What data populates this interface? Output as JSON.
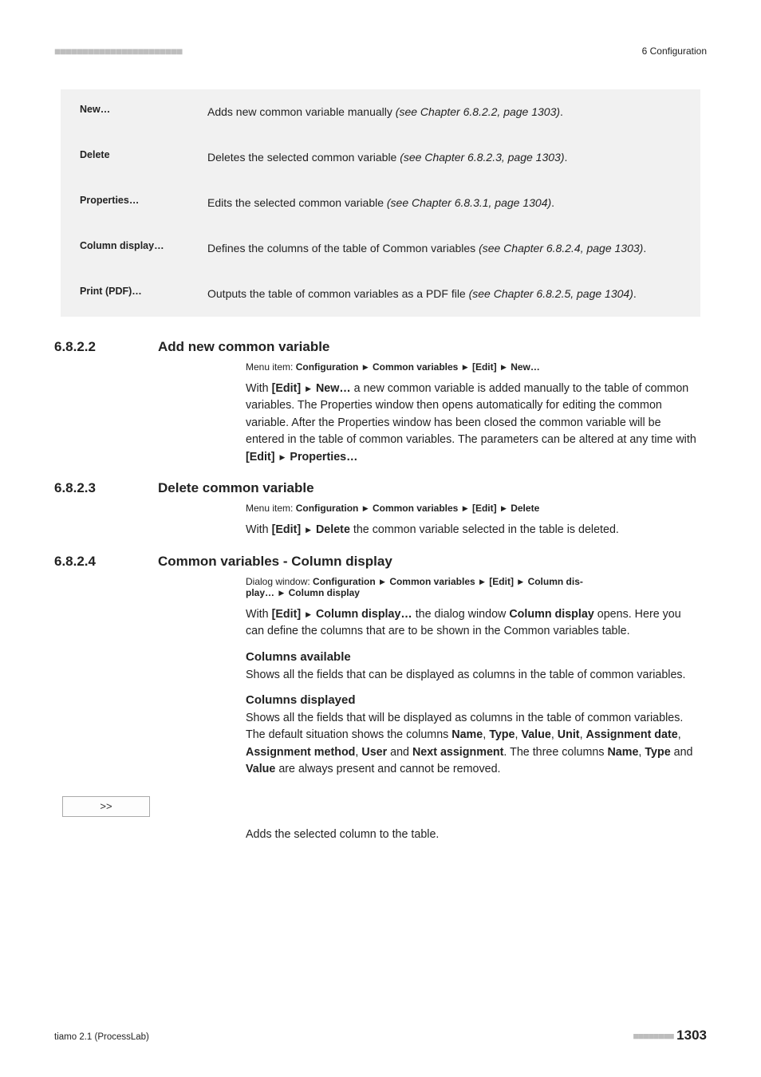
{
  "header": {
    "dashes": "■■■■■■■■■■■■■■■■■■■■■■■",
    "right": "6 Configuration"
  },
  "definitions": [
    {
      "term": "New…",
      "desc_pre": "Adds new common variable manually ",
      "desc_ital": "(see Chapter 6.8.2.2, page 1303)",
      "desc_post": "."
    },
    {
      "term": "Delete",
      "desc_pre": "Deletes the selected common variable ",
      "desc_ital": "(see Chapter 6.8.2.3, page 1303)",
      "desc_post": "."
    },
    {
      "term": "Properties…",
      "desc_pre": "Edits the selected common variable ",
      "desc_ital": "(see Chapter 6.8.3.1, page 1304)",
      "desc_post": "."
    },
    {
      "term": "Column display…",
      "desc_pre": "Defines the columns of the table of Common variables ",
      "desc_ital": "(see Chapter 6.8.2.4, page 1303)",
      "desc_post": "."
    },
    {
      "term": "Print (PDF)…",
      "desc_pre": "Outputs the table of common variables as a PDF file ",
      "desc_ital": "(see Chapter 6.8.2.5, page 1304)",
      "desc_post": "."
    }
  ],
  "s1": {
    "num": "6.8.2.2",
    "title": "Add new common variable",
    "menu_prefix": "Menu item: ",
    "menu_parts": [
      "Configuration",
      "Common variables",
      "[Edit]",
      "New…"
    ],
    "para_lead": "With ",
    "para_bold1": "[Edit] ",
    "para_bold2": "New…",
    "para_body": " a new common variable is added manually to the table of common variables. The Properties window then opens automatically for editing the common variable. After the Properties window has been closed the common variable will be entered in the table of common variables. The parameters can be altered at any time with ",
    "para_bold3": "[Edit] ",
    "para_bold4": "Properties…"
  },
  "s2": {
    "num": "6.8.2.3",
    "title": "Delete common variable",
    "menu_prefix": "Menu item: ",
    "menu_parts": [
      "Configuration",
      "Common variables",
      "[Edit]",
      "Delete"
    ],
    "para_lead": "With ",
    "para_bold1": "[Edit] ",
    "para_bold2": "Delete",
    "para_body": " the common variable selected in the table is deleted."
  },
  "s3": {
    "num": "6.8.2.4",
    "title": "Common variables - Column display",
    "menu_prefix": "Dialog window: ",
    "menu_parts_line1": [
      "Configuration",
      "Common variables",
      "[Edit]",
      "Column dis-"
    ],
    "menu_parts_line2a": "play… ",
    "menu_parts_line2b": "Column display",
    "p1_lead": "With ",
    "p1_bold1": "[Edit] ",
    "p1_bold2": "Column display…",
    "p1_mid": " the dialog window ",
    "p1_bold3": "Column display",
    "p1_tail": " opens. Here you can define the columns that are to be shown in the Common variables table.",
    "sub1": "Columns available",
    "p2": "Shows all the fields that can be displayed as columns in the table of common variables.",
    "sub2": "Columns displayed",
    "p3_a": "Shows all the fields that will be displayed as columns in the table of common variables. The default situation shows the columns ",
    "p3_b_name": "Name",
    "p3_c": ", ",
    "p3_b_type": "Type",
    "p3_d": ", ",
    "p3_b_value": "Value",
    "p3_e": ", ",
    "p3_b_unit": "Unit",
    "p3_f": ", ",
    "p3_b_asgdate": "Assignment date",
    "p3_g": ", ",
    "p3_b_asgmeth": "Assignment method",
    "p3_h": ", ",
    "p3_b_user": "User",
    "p3_i": " and ",
    "p3_b_next": "Next assignment",
    "p3_j": ". The three columns ",
    "p3_b_name2": "Name",
    "p3_k": ", ",
    "p3_b_type2": "Type",
    "p3_l": " and ",
    "p3_b_value2": "Value",
    "p3_m": " are always present and cannot be removed.",
    "button_label": ">>",
    "p4": "Adds the selected column to the table."
  },
  "footer": {
    "left": "tiamo 2.1 (ProcessLab)",
    "dashes": "■■■■■■■■",
    "page": "1303"
  },
  "tri": "▶"
}
